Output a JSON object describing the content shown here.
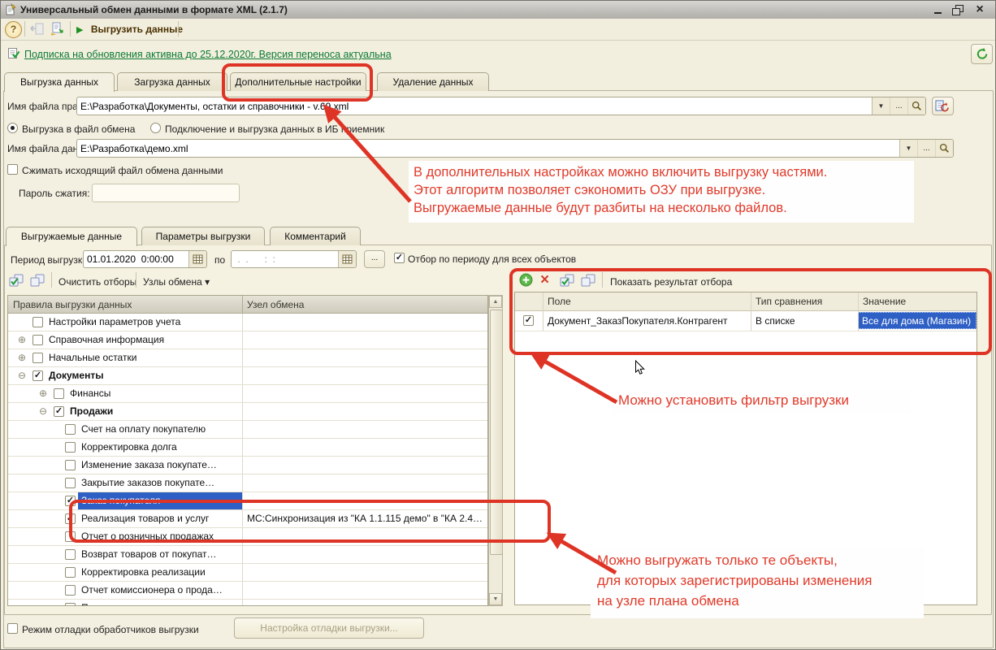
{
  "window": {
    "title": "Универсальный обмен данными в формате XML (2.1.7)"
  },
  "toolbar": {
    "export_label": "Выгрузить данные"
  },
  "status_link": "Подписка на обновления активна до 25.12.2020г. Версия переноса актуальна",
  "main_tabs": [
    {
      "label": "Выгрузка данных",
      "active": true
    },
    {
      "label": "Загрузка данных",
      "active": false
    },
    {
      "label": "Дополнительные настройки",
      "active": false
    },
    {
      "label": "Удаление данных",
      "active": false
    }
  ],
  "fields": {
    "rules_label": "Имя файла правил:",
    "rules_value": "E:\\Разработка\\Документы, остатки и справочники - v.69.xml",
    "data_label": "Имя файла данных:",
    "data_value": "E:\\Разработка\\демо.xml"
  },
  "radios": [
    {
      "label": "Выгрузка в файл обмена",
      "checked": true
    },
    {
      "label": "Подключение и выгрузка данных в ИБ приемник",
      "checked": false
    }
  ],
  "compress_checkbox_label": "Сжимать исходящий файл обмена данными",
  "password_label": "Пароль сжатия:",
  "inner_tabs": [
    {
      "label": "Выгружаемые данные",
      "active": true
    },
    {
      "label": "Параметры выгрузки",
      "active": false
    },
    {
      "label": "Комментарий",
      "active": false
    }
  ],
  "period": {
    "label": "Период выгрузки:",
    "from_value": "01.01.2020  0:00:00",
    "to_label": "по",
    "to_placeholder": " .  .      :  :",
    "filter_checkbox_label": "Отбор по периоду для всех объектов"
  },
  "left_toolbar": {
    "clear_label": "Очистить отборы",
    "nodes_label": "Узлы обмена"
  },
  "tree": {
    "headers": [
      "Правила выгрузки данных",
      "Узел обмена"
    ],
    "rows": [
      {
        "label": "Настройки параметров учета",
        "level": 1,
        "checked": false,
        "node": ""
      },
      {
        "label": "Справочная информация",
        "level": 1,
        "expand": "plus",
        "checked": false,
        "node": ""
      },
      {
        "label": "Начальные остатки",
        "level": 1,
        "expand": "plus",
        "checked": false,
        "node": ""
      },
      {
        "label": "Документы",
        "level": 1,
        "expand": "minus",
        "checked": true,
        "bold": true,
        "node": ""
      },
      {
        "label": "Финансы",
        "level": 2,
        "expand": "plus",
        "checked": false,
        "node": ""
      },
      {
        "label": "Продажи",
        "level": 2,
        "expand": "minus",
        "checked": true,
        "bold": true,
        "node": ""
      },
      {
        "label": "Счет на оплату покупателю",
        "level": 3,
        "checked": false,
        "node": ""
      },
      {
        "label": "Корректировка долга",
        "level": 3,
        "checked": false,
        "node": ""
      },
      {
        "label": "Изменение заказа покупате…",
        "level": 3,
        "checked": false,
        "node": ""
      },
      {
        "label": "Закрытие заказов покупате…",
        "level": 3,
        "checked": false,
        "node": ""
      },
      {
        "label": "Заказ покупателя",
        "level": 3,
        "checked": true,
        "selected": true,
        "node": ""
      },
      {
        "label": "Реализация товаров и услуг",
        "level": 3,
        "checked": true,
        "node": "МС:Синхронизация из \"КА 1.1.115 демо\" в \"КА 2.4…"
      },
      {
        "label": "Отчет о розничных продажах",
        "level": 3,
        "checked": false,
        "node": ""
      },
      {
        "label": "Возврат товаров от покупат…",
        "level": 3,
        "checked": false,
        "node": ""
      },
      {
        "label": "Корректировка реализации",
        "level": 3,
        "checked": false,
        "node": ""
      },
      {
        "label": "Отчет комиссионера о прода…",
        "level": 3,
        "checked": false,
        "node": ""
      },
      {
        "label": "План продаж",
        "level": 3,
        "checked": false,
        "node": ""
      }
    ]
  },
  "filter_toolbar": {
    "show_result_label": "Показать результат отбора"
  },
  "filter_table": {
    "headers": [
      "Поле",
      "Тип сравнения",
      "Значение"
    ],
    "rows": [
      {
        "checked": true,
        "field": "Документ_ЗаказПокупателя.Контрагент",
        "comparison": "В списке",
        "value": "Все для дома (Магазин)"
      }
    ]
  },
  "bottom": {
    "debug_checkbox_label": "Режим отладки обработчиков выгрузки",
    "debug_button_label": "Настройка отладки выгрузки..."
  },
  "annotations": {
    "parts": [
      "В дополнительных настройках можно включить выгрузку частями.",
      "Этот алгоритм позволяет сэкономить ОЗУ при выгрузке.",
      "Выгружаемые данные будут разбиты на несколько файлов."
    ],
    "filter": "Можно установить фильтр выгрузки",
    "registered": [
      "Можно выгружать только те объекты,",
      "для которых зарегистрированы изменения",
      "на узле плана обмена"
    ]
  },
  "icons": {
    "help": "?",
    "play": "▶",
    "dropdown": "▼",
    "menu_arrow": "▾",
    "ellipsis": "...",
    "plus": "⊕",
    "minus": "⊖",
    "check": "✓",
    "close": "×",
    "red_x": "×",
    "scroll_up": "▲",
    "scroll_down": "▼"
  },
  "colors": {
    "annotation_red": "#DE3425",
    "selection_blue": "#2E5FC4",
    "link_green": "#0B7A33"
  }
}
